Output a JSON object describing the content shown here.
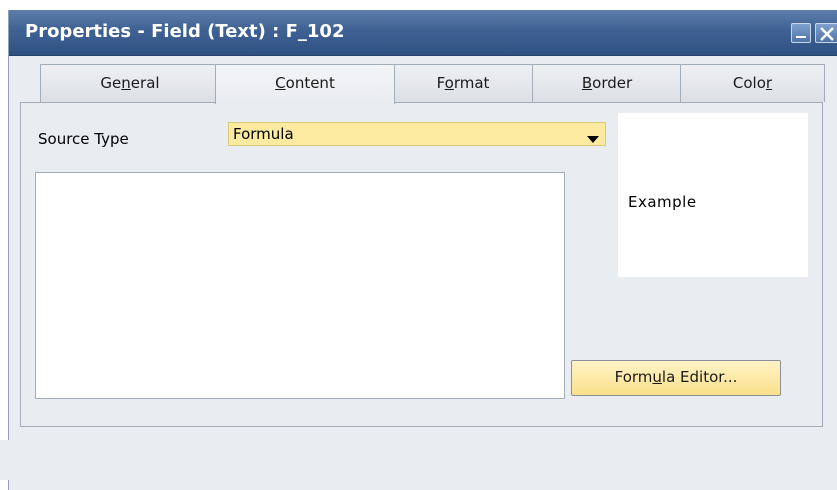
{
  "window": {
    "title": "Properties - Field (Text) : F_102"
  },
  "tabs": [
    {
      "label": "General",
      "mnemonic": "n"
    },
    {
      "label": "Content",
      "mnemonic": "C"
    },
    {
      "label": "Format",
      "mnemonic": "o"
    },
    {
      "label": "Border",
      "mnemonic": "B"
    },
    {
      "label": "Color",
      "mnemonic": "r"
    }
  ],
  "active_tab": "Content",
  "content": {
    "source_type_label": "Source Type",
    "source_type_value": "Formula",
    "formula_text": "",
    "example_text": "Example",
    "formula_editor_button": "Formula Editor..."
  },
  "colors": {
    "titlebar": "#3f6193",
    "dropdown_bg": "#fbeaa0",
    "button_bg": "#fbe08b"
  },
  "icons": {
    "minimize": "minimize-icon",
    "close": "close-icon",
    "dropdown": "dropdown-arrow-icon"
  }
}
